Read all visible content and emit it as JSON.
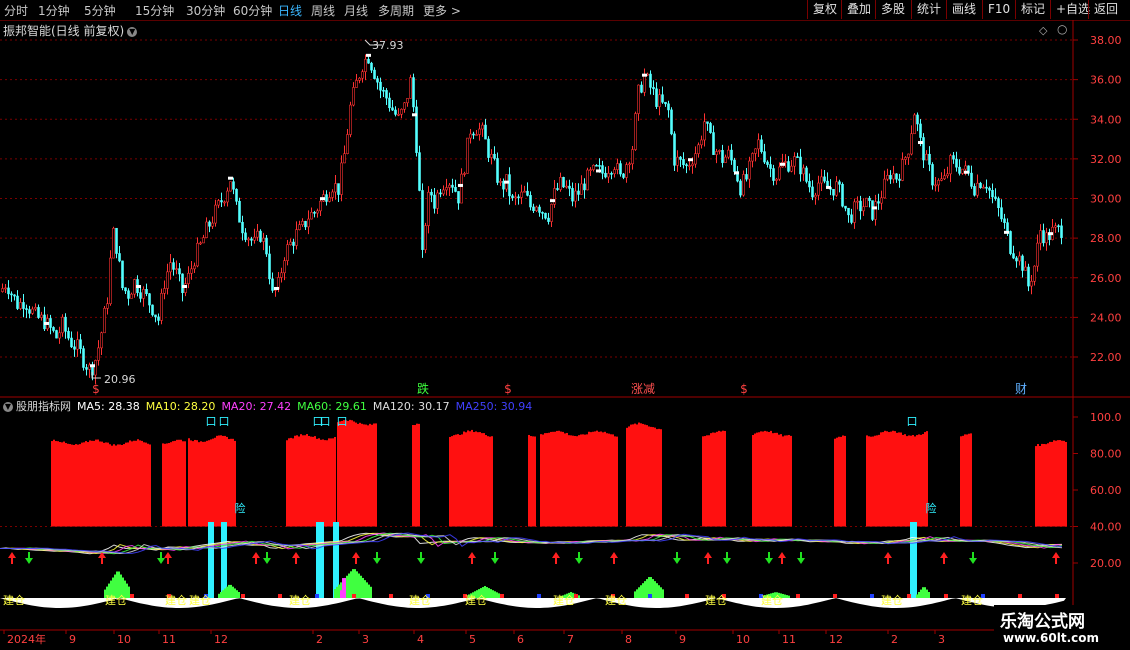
{
  "periods": [
    {
      "label": "分时",
      "active": false
    },
    {
      "label": "1分钟",
      "active": false
    },
    {
      "label": "5分钟",
      "active": false
    },
    {
      "label": "15分钟",
      "active": false
    },
    {
      "label": "30分钟",
      "active": false
    },
    {
      "label": "60分钟",
      "active": false
    },
    {
      "label": "日线",
      "active": true
    },
    {
      "label": "周线",
      "active": false
    },
    {
      "label": "月线",
      "active": false
    },
    {
      "label": "多周期",
      "active": false
    },
    {
      "label": "更多 >",
      "active": false
    }
  ],
  "toolbar": [
    "复权",
    "叠加",
    "多股",
    "统计",
    "画线",
    "F10",
    "标记",
    "+自选",
    "返回"
  ],
  "stock": {
    "title": "振邦智能(日线 前复权)"
  },
  "price_axis": [
    "38.00",
    "36.00",
    "34.00",
    "32.00",
    "30.00",
    "28.00",
    "26.00",
    "24.00",
    "22.00"
  ],
  "annotations": {
    "high": "37.93",
    "low": "20.96"
  },
  "events": [
    {
      "text": "$",
      "color": "#ff4040"
    },
    {
      "text": "跌",
      "color": "#3dff3d"
    },
    {
      "text": "$",
      "color": "#ff4040"
    },
    {
      "text": "涨减",
      "color": "#ff5050"
    },
    {
      "text": "$",
      "color": "#ff4040"
    },
    {
      "text": "财",
      "color": "#60b0ff"
    }
  ],
  "indicator": {
    "name": "股朋指标网",
    "values": [
      {
        "label": "MA5: 28.38",
        "color": "#ffffff"
      },
      {
        "label": "MA10: 28.20",
        "color": "#ffff40"
      },
      {
        "label": "MA20: 27.42",
        "color": "#ff40ff"
      },
      {
        "label": "MA60: 29.61",
        "color": "#40ff40"
      },
      {
        "label": "MA120: 30.17",
        "color": "#dddddd"
      },
      {
        "label": "MA250: 30.94",
        "color": "#4040ff"
      }
    ]
  },
  "indicator_axis": [
    "100.0",
    "80.00",
    "60.00",
    "40.00",
    "20.00"
  ],
  "indicator_markers": {
    "danger": "险",
    "box": "口",
    "build": "建仓",
    "build_full": "建仓",
    "build_s": "S"
  },
  "time_axis": [
    "2024年",
    "9",
    "10",
    "11",
    "12",
    "2",
    "3",
    "4",
    "5",
    "6",
    "7",
    "8",
    "9",
    "10",
    "11",
    "12",
    "2",
    "3"
  ],
  "watermark": {
    "line1": "乐淘公式网",
    "line2": "www.60lt.com"
  },
  "chart_data": {
    "type": "candlestick",
    "title": "振邦智能(日线 前复权)",
    "period": "日线",
    "ylim": [
      20.5,
      38.8
    ],
    "high": 37.93,
    "low": 20.96,
    "last": {
      "MA5": 28.38,
      "MA10": 28.2,
      "MA20": 27.42,
      "MA60": 29.61,
      "MA120": 30.17,
      "MA250": 30.94
    },
    "close_path": [
      [
        0,
        25.3
      ],
      [
        6,
        25.8
      ],
      [
        12,
        25.1
      ],
      [
        18,
        24.6
      ],
      [
        24,
        24.9
      ],
      [
        30,
        24.4
      ],
      [
        36,
        24.0
      ],
      [
        44,
        23.8
      ],
      [
        50,
        23.4
      ],
      [
        56,
        23.0
      ],
      [
        62,
        23.6
      ],
      [
        70,
        22.8
      ],
      [
        78,
        22.4
      ],
      [
        84,
        21.8
      ],
      [
        90,
        21.3
      ],
      [
        96,
        22.0
      ],
      [
        102,
        23.5
      ],
      [
        108,
        25.3
      ],
      [
        112,
        28.4
      ],
      [
        116,
        27.6
      ],
      [
        122,
        25.5
      ],
      [
        128,
        25.2
      ],
      [
        134,
        25.8
      ],
      [
        140,
        25.4
      ],
      [
        146,
        25.0
      ],
      [
        152,
        24.5
      ],
      [
        158,
        23.9
      ],
      [
        164,
        25.8
      ],
      [
        170,
        26.8
      ],
      [
        176,
        26.2
      ],
      [
        182,
        25.3
      ],
      [
        188,
        26.0
      ],
      [
        194,
        27.0
      ],
      [
        200,
        27.6
      ],
      [
        206,
        28.4
      ],
      [
        212,
        29.0
      ],
      [
        218,
        29.6
      ],
      [
        224,
        30.2
      ],
      [
        230,
        31.0
      ],
      [
        236,
        29.5
      ],
      [
        242,
        28.6
      ],
      [
        248,
        28.1
      ],
      [
        254,
        27.7
      ],
      [
        260,
        28.2
      ],
      [
        266,
        27.4
      ],
      [
        272,
        25.1
      ],
      [
        278,
        25.6
      ],
      [
        284,
        27.2
      ],
      [
        290,
        27.7
      ],
      [
        296,
        28.2
      ],
      [
        302,
        28.5
      ],
      [
        308,
        29.1
      ],
      [
        314,
        29.3
      ],
      [
        320,
        29.8
      ],
      [
        326,
        30.3
      ],
      [
        332,
        30.7
      ],
      [
        338,
        30.5
      ],
      [
        344,
        32.2
      ],
      [
        350,
        34.6
      ],
      [
        356,
        35.8
      ],
      [
        362,
        36.8
      ],
      [
        368,
        37.2
      ],
      [
        374,
        36.4
      ],
      [
        380,
        35.5
      ],
      [
        386,
        35.1
      ],
      [
        392,
        34.5
      ],
      [
        398,
        34.0
      ],
      [
        404,
        34.6
      ],
      [
        410,
        35.9
      ],
      [
        414,
        34.2
      ],
      [
        418,
        31.3
      ],
      [
        422,
        27.0
      ],
      [
        426,
        29.5
      ],
      [
        430,
        30.4
      ],
      [
        434,
        29.8
      ],
      [
        440,
        30.6
      ],
      [
        446,
        31.0
      ],
      [
        452,
        30.8
      ],
      [
        458,
        30.1
      ],
      [
        464,
        31.7
      ],
      [
        470,
        33.5
      ],
      [
        476,
        33.6
      ],
      [
        482,
        33.3
      ],
      [
        488,
        32.4
      ],
      [
        494,
        31.6
      ],
      [
        500,
        30.6
      ],
      [
        506,
        30.8
      ],
      [
        512,
        29.8
      ],
      [
        518,
        30.0
      ],
      [
        524,
        30.2
      ],
      [
        530,
        29.6
      ],
      [
        536,
        29.8
      ],
      [
        542,
        29.4
      ],
      [
        548,
        29.2
      ],
      [
        554,
        30.2
      ],
      [
        560,
        30.7
      ],
      [
        566,
        30.5
      ],
      [
        572,
        30.0
      ],
      [
        578,
        30.3
      ],
      [
        584,
        30.8
      ],
      [
        590,
        31.2
      ],
      [
        596,
        31.4
      ],
      [
        602,
        31.3
      ],
      [
        608,
        31.6
      ],
      [
        614,
        31.8
      ],
      [
        620,
        31.0
      ],
      [
        626,
        31.8
      ],
      [
        632,
        32.6
      ],
      [
        638,
        35.3
      ],
      [
        644,
        36.2
      ],
      [
        650,
        35.6
      ],
      [
        656,
        35.0
      ],
      [
        662,
        34.7
      ],
      [
        668,
        34.4
      ],
      [
        674,
        32.0
      ],
      [
        680,
        31.8
      ],
      [
        686,
        31.6
      ],
      [
        692,
        32.1
      ],
      [
        698,
        32.6
      ],
      [
        704,
        33.9
      ],
      [
        710,
        32.9
      ],
      [
        716,
        32.4
      ],
      [
        722,
        32.0
      ],
      [
        728,
        32.2
      ],
      [
        734,
        31.6
      ],
      [
        740,
        30.6
      ],
      [
        746,
        31.0
      ],
      [
        752,
        31.9
      ],
      [
        758,
        32.8
      ],
      [
        764,
        32.2
      ],
      [
        770,
        31.5
      ],
      [
        776,
        31.2
      ],
      [
        782,
        31.7
      ],
      [
        788,
        31.8
      ],
      [
        794,
        31.9
      ],
      [
        800,
        31.6
      ],
      [
        806,
        30.9
      ],
      [
        812,
        30.4
      ],
      [
        818,
        30.8
      ],
      [
        824,
        30.6
      ],
      [
        830,
        30.5
      ],
      [
        836,
        30.6
      ],
      [
        842,
        30.0
      ],
      [
        848,
        29.0
      ],
      [
        854,
        29.4
      ],
      [
        860,
        29.6
      ],
      [
        866,
        29.7
      ],
      [
        872,
        29.3
      ],
      [
        878,
        29.9
      ],
      [
        884,
        30.6
      ],
      [
        890,
        31.3
      ],
      [
        896,
        31.1
      ],
      [
        902,
        31.6
      ],
      [
        908,
        32.6
      ],
      [
        914,
        34.4
      ],
      [
        920,
        32.8
      ],
      [
        926,
        31.8
      ],
      [
        932,
        31.0
      ],
      [
        938,
        30.8
      ],
      [
        944,
        30.9
      ],
      [
        950,
        31.8
      ],
      [
        956,
        31.7
      ],
      [
        962,
        31.5
      ],
      [
        968,
        31.2
      ],
      [
        974,
        30.6
      ],
      [
        980,
        30.9
      ],
      [
        986,
        30.8
      ],
      [
        992,
        30.0
      ],
      [
        998,
        29.4
      ],
      [
        1004,
        28.6
      ],
      [
        1010,
        27.6
      ],
      [
        1016,
        27.2
      ],
      [
        1022,
        26.7
      ],
      [
        1028,
        25.6
      ],
      [
        1034,
        26.6
      ],
      [
        1040,
        28.4
      ],
      [
        1046,
        28.0
      ],
      [
        1052,
        28.3
      ],
      [
        1058,
        28.4
      ],
      [
        1063,
        28.5
      ]
    ],
    "indicator_blocks": [
      [
        51,
        150,
        86
      ],
      [
        162,
        185,
        86
      ],
      [
        188,
        235,
        88
      ],
      [
        286,
        335,
        89
      ],
      [
        337,
        376,
        97
      ],
      [
        412,
        418,
        97
      ],
      [
        449,
        492,
        91
      ],
      [
        528,
        534,
        91
      ],
      [
        540,
        546,
        91
      ],
      [
        548,
        616,
        91
      ],
      [
        626,
        660,
        95
      ],
      [
        702,
        725,
        91
      ],
      [
        752,
        790,
        91
      ],
      [
        834,
        844,
        89
      ],
      [
        866,
        927,
        91
      ],
      [
        960,
        970,
        90
      ],
      [
        1035,
        1066,
        86
      ]
    ],
    "cyan_bars": [
      [
        208,
        214
      ],
      [
        221,
        227
      ],
      [
        316,
        324
      ],
      [
        333,
        339
      ],
      [
        910,
        917
      ]
    ]
  }
}
